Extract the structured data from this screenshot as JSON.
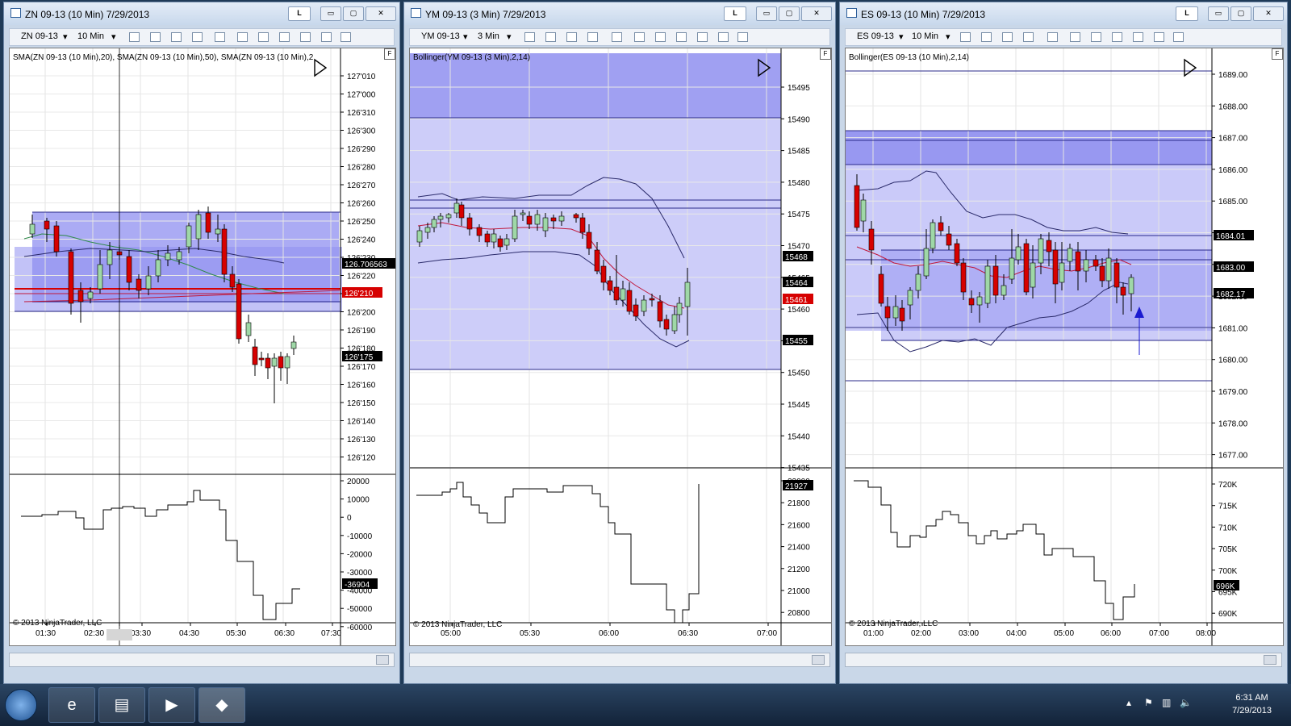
{
  "colors": {
    "up": "#9fd8a7",
    "down": "#d60000",
    "band": "#8f8ff0",
    "bandLight": "#c4c4f8",
    "sma": "#c0183b",
    "smaGreen": "#2f8a4a"
  },
  "windows": [
    {
      "title": "ZN 09-13 (10 Min)  7/29/2013",
      "symbol": "ZN 09-13",
      "interval": "10 Min",
      "indicator": "SMA(ZN 09-13 (10 Min),20), SMA(ZN 09-13 (10 Min),50), SMA(ZN 09-13 (10 Min),2",
      "copyright": "© 2013 NinjaTrader, LLC",
      "price_ticks": [
        "127'010",
        "127'000",
        "126'310",
        "126'300",
        "126'290",
        "126'280",
        "126'270",
        "126'260",
        "126'250",
        "126'240",
        "126'230",
        "126'220",
        "126'210",
        "126'200",
        "126'190",
        "126'180",
        "126'170",
        "126'160",
        "126'150",
        "126'140",
        "126'130",
        "126'120"
      ],
      "price_tags": [
        "126.706563",
        "126'210",
        "126'175"
      ],
      "vol_ticks": [
        "20000",
        "10000",
        "0",
        "-10000",
        "-20000",
        "-30000",
        "-40000",
        "-50000",
        "-60000"
      ],
      "vol_tag": "-36904",
      "time_ticks": [
        "01:30",
        "02:30",
        "03:00",
        "03:30",
        "04:30",
        "05:30",
        "06:30",
        "07:30"
      ]
    },
    {
      "title": "YM 09-13 (3 Min)  7/29/2013",
      "symbol": "YM 09-13",
      "interval": "3 Min",
      "indicator": "Bollinger(YM 09-13 (3 Min),2,14)",
      "copyright": "© 2013 NinjaTrader, LLC",
      "price_ticks": [
        "15495",
        "15490",
        "15485",
        "15480",
        "15475",
        "15470",
        "15465",
        "15460",
        "15455",
        "15450",
        "15445",
        "15440",
        "15435"
      ],
      "price_tags": [
        "15468",
        "15464",
        "15461",
        "15455"
      ],
      "vol_ticks": [
        "22000",
        "21800",
        "21600",
        "21400",
        "21200",
        "21000",
        "20800"
      ],
      "vol_tag": "21927",
      "time_ticks": [
        "05:00",
        "05:30",
        "06:00",
        "06:30",
        "07:00"
      ]
    },
    {
      "title": "ES 09-13 (10 Min)  7/29/2013",
      "symbol": "ES 09-13",
      "interval": "10 Min",
      "indicator": "Bollinger(ES 09-13 (10 Min),2,14)",
      "copyright": "© 2013 NinjaTrader, LLC",
      "price_ticks": [
        "1689.00",
        "1688.00",
        "1687.00",
        "1686.00",
        "1685.00",
        "1684.00",
        "1683.00",
        "1682.00",
        "1681.00",
        "1680.00",
        "1679.00",
        "1678.00",
        "1677.00"
      ],
      "price_tags": [
        "1684.01",
        "1683.00",
        "1682.17"
      ],
      "vol_ticks": [
        "720K",
        "715K",
        "710K",
        "705K",
        "700K",
        "695K",
        "690K"
      ],
      "vol_tag": "696K",
      "time_ticks": [
        "01:00",
        "02:00",
        "03:00",
        "04:00",
        "05:00",
        "06:00",
        "07:00",
        "08:00"
      ]
    }
  ],
  "taskbar": {
    "time": "6:31 AM",
    "date": "7/29/2013"
  },
  "buttons": {
    "lock": "L",
    "min": "▭",
    "max": "▢",
    "close": "✕",
    "f": "F"
  }
}
